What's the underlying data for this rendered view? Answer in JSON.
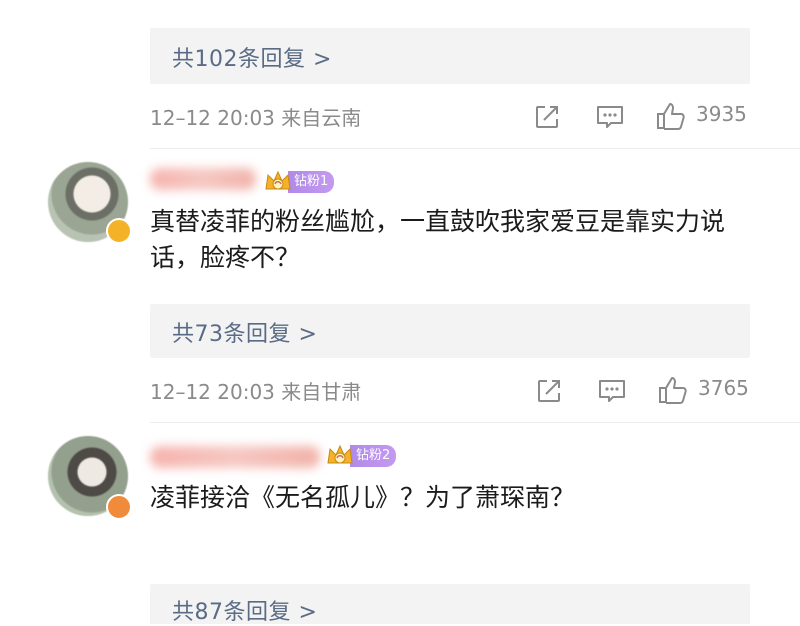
{
  "threads": [
    {
      "reply_label": "共102条回复 >",
      "meta": "12–12 20:03  来自云南",
      "likes": "3935"
    },
    {
      "user_badge": "钻粉1",
      "comment": "真替凌菲的粉丝尴尬，一直鼓吹我家爱豆是靠实力说话，脸疼不？",
      "reply_label": "共73条回复 >",
      "meta": "12–12 20:03  来自甘肃",
      "likes": "3765"
    },
    {
      "user_badge": "钻粉2",
      "comment": "凌菲接洽《无名孤儿》？为了萧琛南？",
      "reply_label": "共87条回复 >"
    }
  ],
  "icons": {
    "share": "share-icon",
    "comment": "comment-icon",
    "like": "thumbs-up-icon"
  },
  "colors": {
    "reply_text": "#5a6b86",
    "meta_text": "#8a8a8a",
    "reply_box_bg": "#f3f3f3",
    "badge_purple": "#b08ae8",
    "crown_gold": "#f3b227"
  }
}
